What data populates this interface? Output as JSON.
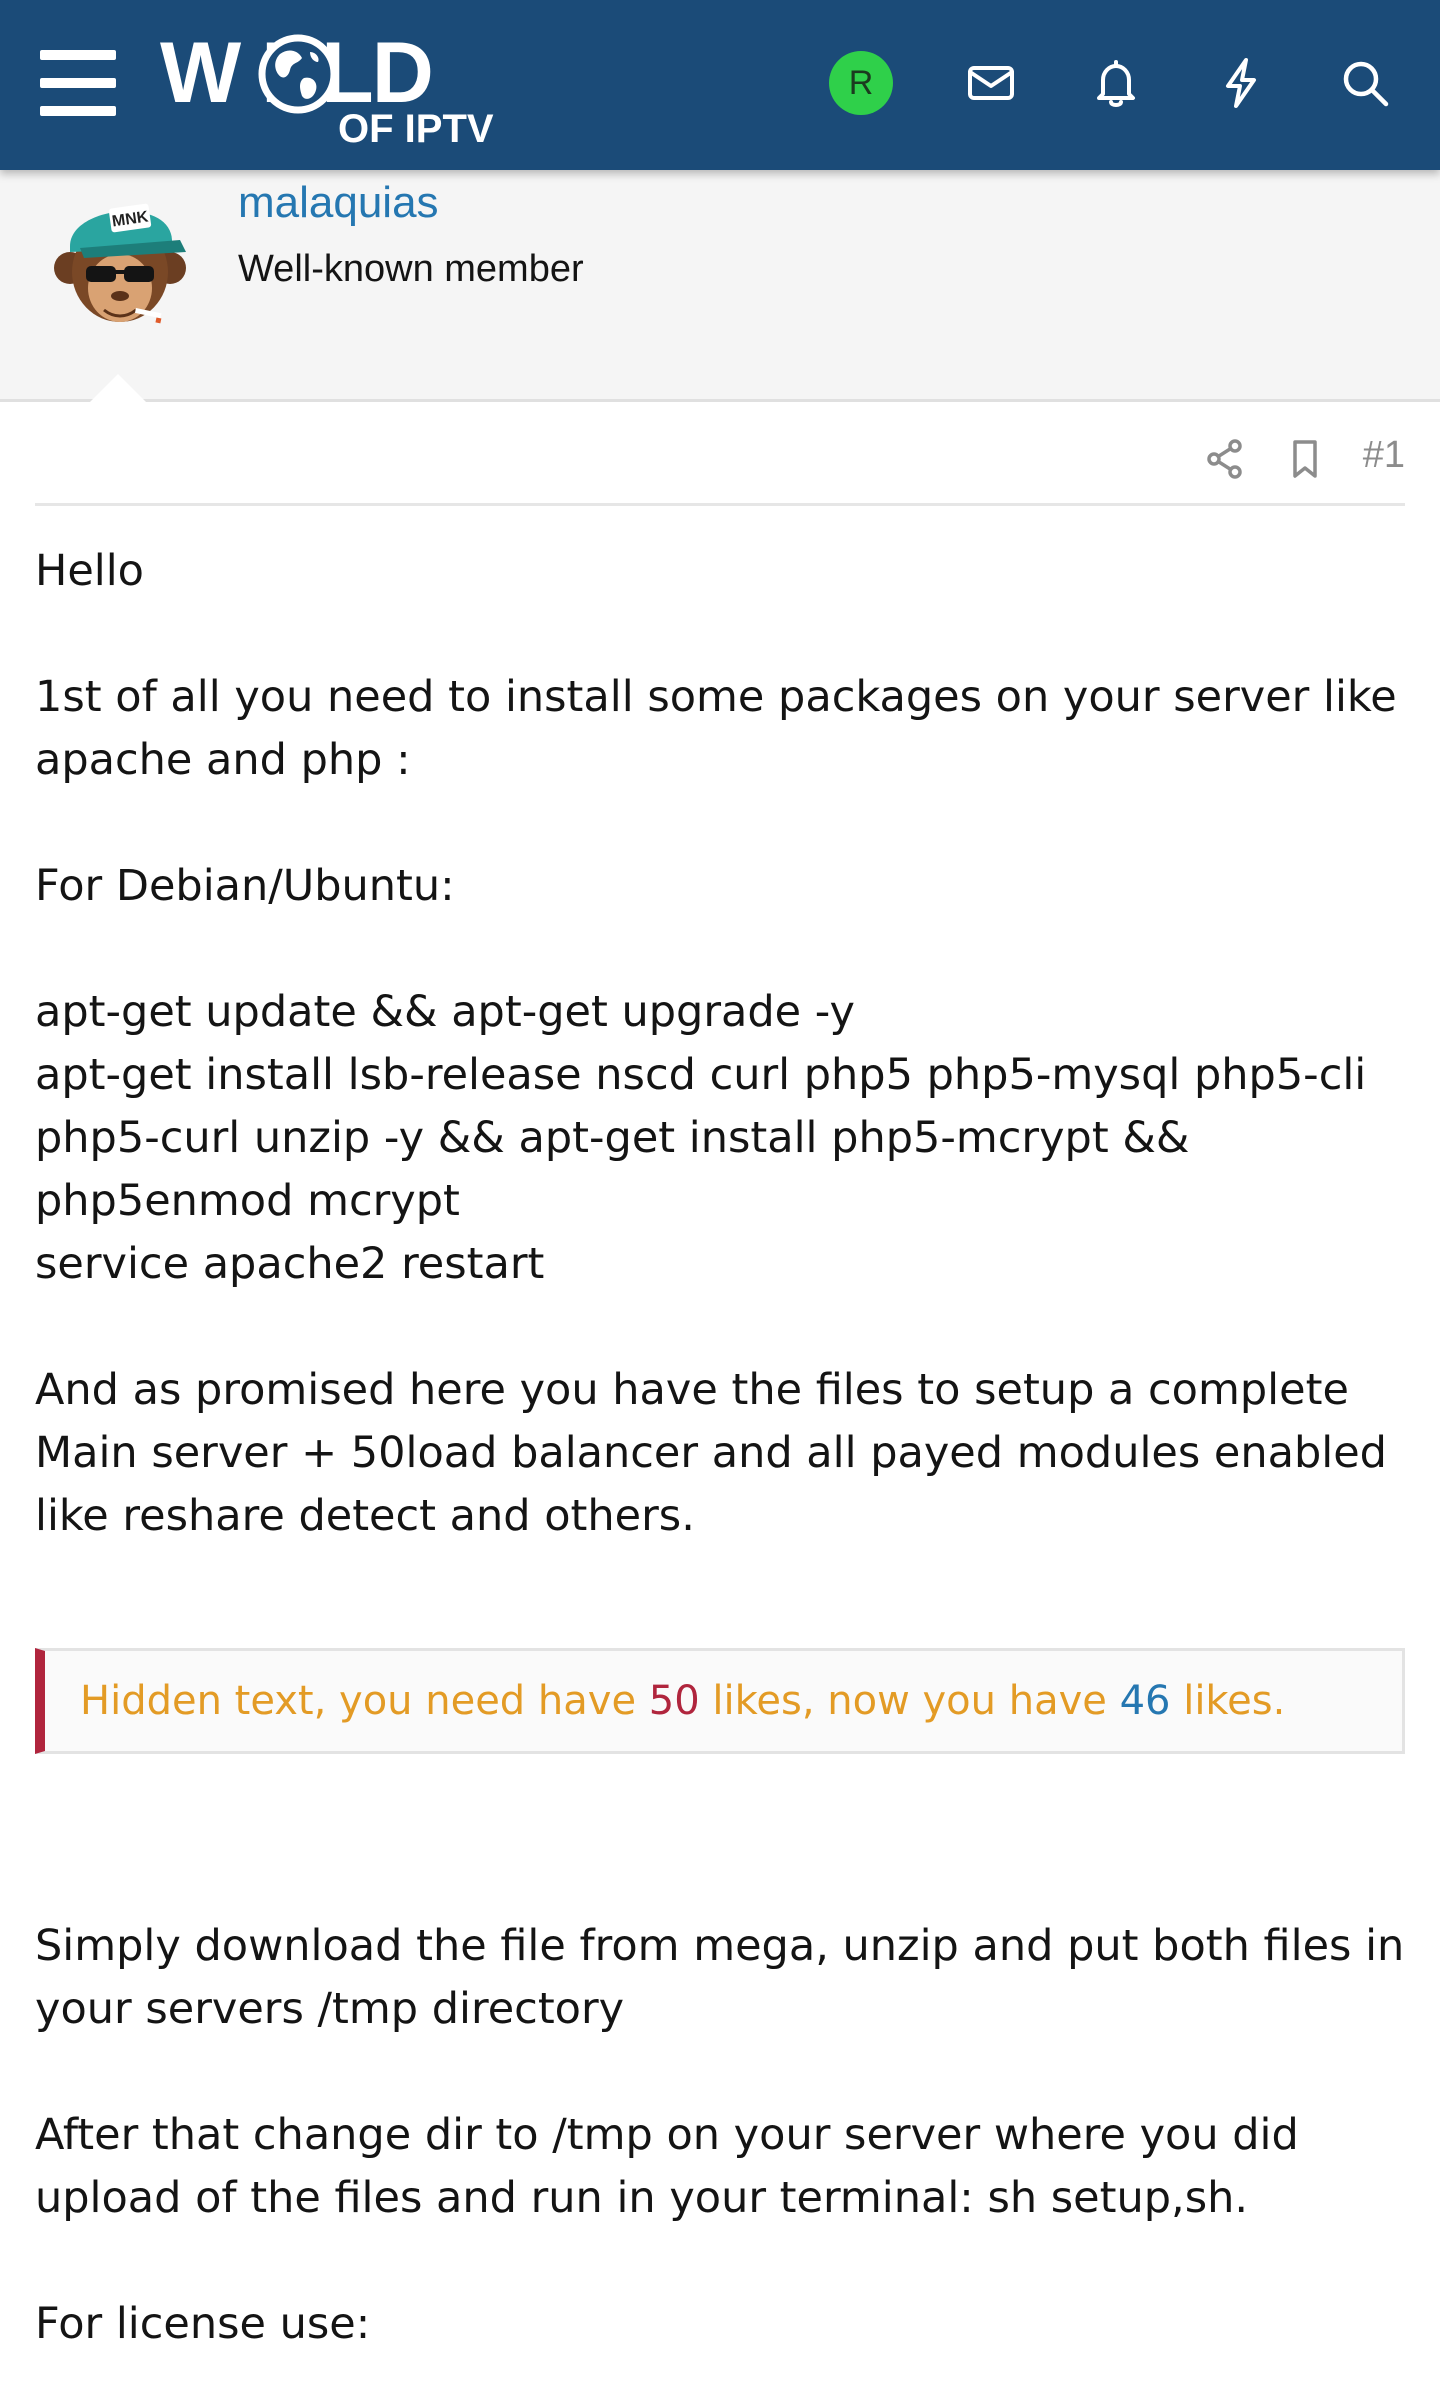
{
  "header": {
    "logo_line1": "W RLD",
    "logo_line2": "OF IPTV",
    "avatar_letter": "R",
    "background": "#1b4b78",
    "avatar_color": "#2fd04a",
    "icons": [
      "menu-icon",
      "envelope-icon",
      "bell-icon",
      "bolt-icon",
      "search-icon"
    ]
  },
  "member": {
    "name": "malaquias",
    "title": "Well-known member",
    "avatar_caption": "MNK"
  },
  "post": {
    "number": "#1",
    "icons": [
      "share-icon",
      "bookmark-icon"
    ],
    "paragraphs": [
      "Hello",
      "1st of all you need to install some packages on your server like apache and php :",
      "For Debian/Ubuntu:",
      "apt-get update && apt-get upgrade -y\napt-get install lsb-release nscd curl php5 php5-mysql php5-cli php5-curl unzip -y && apt-get install php5-mcrypt && php5enmod mcrypt\nservice apache2 restart",
      "And as promised here you have the files to setup a complete Main server + 50load balancer and all payed modules enabled like reshare detect and others."
    ],
    "hidden": {
      "prefix": "Hidden text, you need have ",
      "required": "50",
      "middle": " likes, now you have ",
      "current": "46",
      "suffix": " likes."
    },
    "paragraphs_after": [
      "Simply download the file from mega, unzip and put both files in your servers /tmp directory",
      "After that change dir to /tmp on your server where you did upload of the files and run in your terminal: sh setup,sh.",
      "For license use:"
    ]
  }
}
